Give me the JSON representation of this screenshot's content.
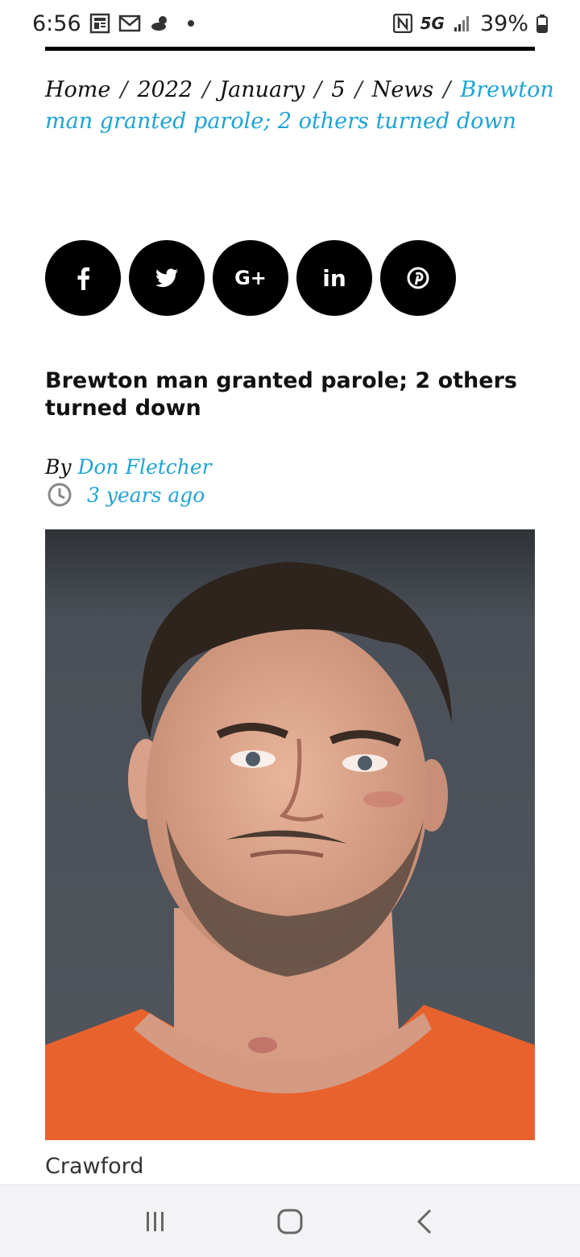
{
  "status_bar": {
    "time": "6:56",
    "network": "5G",
    "battery": "39%",
    "icons": [
      "news-icon",
      "gmail-icon",
      "weather-icon",
      "nfc-icon",
      "signal-icon",
      "battery-icon"
    ]
  },
  "breadcrumb": {
    "items": [
      "Home",
      "2022",
      "January",
      "5",
      "News"
    ],
    "separator": "/",
    "current": "Brewton man granted parole; 2 others turned down"
  },
  "share": {
    "buttons": [
      {
        "name": "facebook",
        "icon": "facebook-icon"
      },
      {
        "name": "twitter",
        "icon": "twitter-icon"
      },
      {
        "name": "google-plus",
        "icon": "google-plus-icon",
        "label": "G+"
      },
      {
        "name": "linkedin",
        "icon": "linkedin-icon",
        "label": "in"
      },
      {
        "name": "pinterest",
        "icon": "pinterest-icon"
      }
    ]
  },
  "article": {
    "title": "Brewton man granted parole; 2 others turned down",
    "by_label": "By",
    "author": "Don Fletcher",
    "time_ago": "3 years ago",
    "image_caption": "Crawford"
  },
  "nav_bar": {
    "buttons": [
      "recent-apps-icon",
      "home-icon",
      "back-icon"
    ]
  },
  "colors": {
    "link": "#1fa3d4",
    "share_bg": "#000000",
    "jumpsuit": "#e8622e"
  }
}
